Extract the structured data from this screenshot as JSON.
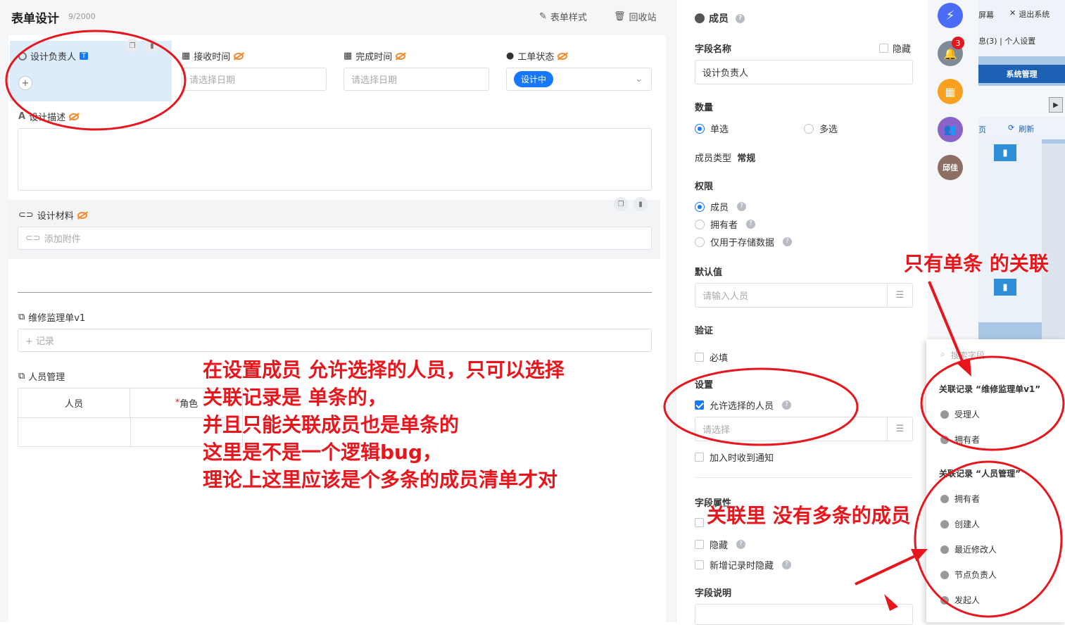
{
  "header": {
    "title": "表单设计",
    "count": "9/2000",
    "style_btn": "表单样式",
    "recycle_btn": "回收站"
  },
  "fields": {
    "owner": {
      "label": "设计负责人",
      "badge": "T",
      "add": "+"
    },
    "receive": {
      "label": "接收时间",
      "placeholder": "请选择日期"
    },
    "finish": {
      "label": "完成时间",
      "placeholder": "请选择日期"
    },
    "status": {
      "label": "工单状态",
      "value": "设计中"
    },
    "desc": {
      "label": "设计描述"
    },
    "material": {
      "label": "设计材料",
      "placeholder": "添加附件"
    },
    "repair": {
      "label": "维修监理单v1",
      "placeholder": "+ 记录"
    },
    "staff": {
      "label": "人员管理",
      "col1": "人员",
      "col2": "角色"
    }
  },
  "panel": {
    "title": "成员",
    "field_name_label": "字段名称",
    "hide_label": "隐藏",
    "field_name_value": "设计负责人",
    "quantity_label": "数量",
    "single": "单选",
    "multi": "多选",
    "member_type_label": "成员类型",
    "member_type_value": "常规",
    "perm_label": "权限",
    "perm_member": "成员",
    "perm_owner": "拥有者",
    "perm_storage": "仅用于存储数据",
    "default_label": "默认值",
    "default_placeholder": "请输入人员",
    "validate_label": "验证",
    "required": "必填",
    "setting_label": "设置",
    "allow_select": "允许选择的人员",
    "select_placeholder": "请选择",
    "notify": "加入时收到通知",
    "attr_label": "字段属性",
    "attr_hide": "隐藏",
    "attr_new_hide": "新增记录时隐藏",
    "desc_label": "字段说明"
  },
  "strip": {
    "bell_count": "3",
    "avatar_text": "邱佳"
  },
  "legacy": {
    "screen": "屏幕",
    "logout": "退出系统",
    "msg": "息(3)",
    "sep": "|",
    "personal": "个人设置",
    "sys": "系统管理",
    "page": "页",
    "refresh": "刷新"
  },
  "popup": {
    "search_placeholder": "搜索字段",
    "group1_title": "关联记录 “维修监理单v1”",
    "group1_items": [
      "受理人",
      "拥有者"
    ],
    "group2_title": "关联记录 “人员管理”",
    "group2_items": [
      "拥有者",
      "创建人",
      "最近修改人",
      "节点负责人",
      "发起人"
    ]
  },
  "annotations": {
    "main": [
      "在设置成员 允许选择的人员，只可以选择",
      "关联记录是 单条的，",
      "并且只能关联成员也是单条的",
      "这里是不是一个逻辑bug，",
      "理论上这里应该是个多条的成员清单才对"
    ],
    "top_right": "只有单条 的关联",
    "bottom": "关联里 没有多条的成员"
  },
  "colors": {
    "accent": "#1677ff",
    "annotation": "#e8161c",
    "eye": "#f58a2a"
  }
}
